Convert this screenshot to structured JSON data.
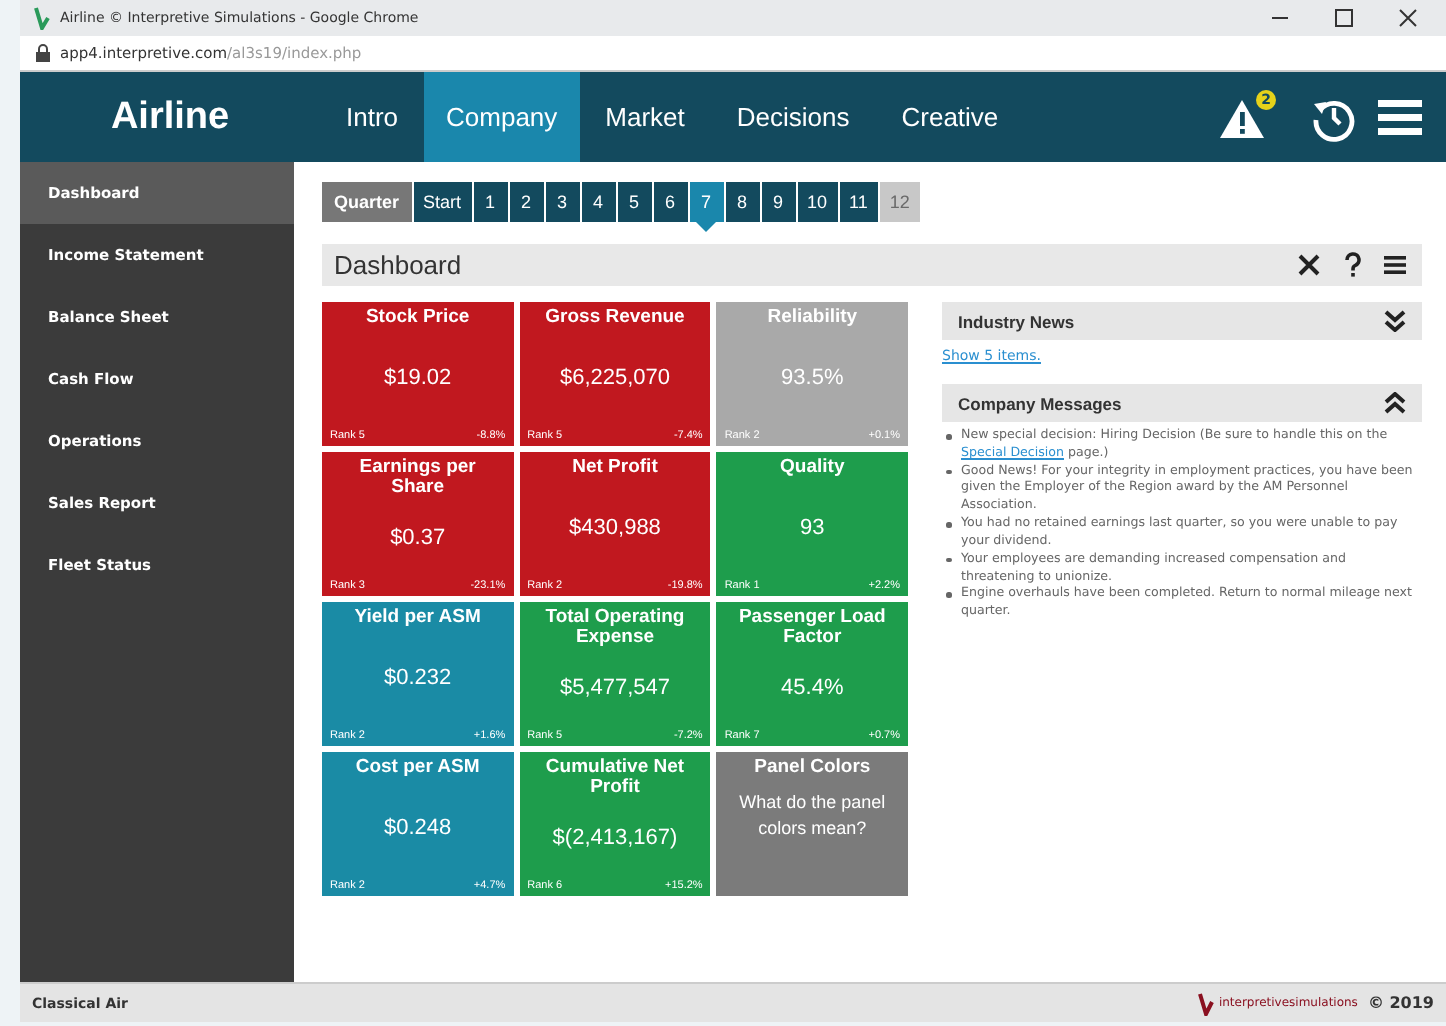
{
  "browser": {
    "title": "Airline © Interpretive Simulations - Google Chrome",
    "url_host": "app4.interpretive.com",
    "url_path": "/al3s19/index.php"
  },
  "app": {
    "brand": "Airline",
    "alert_count": "2"
  },
  "nav": [
    {
      "label": "Intro",
      "selected": false
    },
    {
      "label": "Company",
      "selected": true
    },
    {
      "label": "Market",
      "selected": false
    },
    {
      "label": "Decisions",
      "selected": false
    },
    {
      "label": "Creative",
      "selected": false
    }
  ],
  "sidebar": {
    "items": [
      {
        "label": "Dashboard",
        "selected": true
      },
      {
        "label": "Income Statement",
        "selected": false
      },
      {
        "label": "Balance Sheet",
        "selected": false
      },
      {
        "label": "Cash Flow",
        "selected": false
      },
      {
        "label": "Operations",
        "selected": false
      },
      {
        "label": "Sales Report",
        "selected": false
      },
      {
        "label": "Fleet Status",
        "selected": false
      }
    ]
  },
  "quarters": {
    "label": "Quarter",
    "items": [
      {
        "label": "Start",
        "selected": false,
        "disabled": false
      },
      {
        "label": "1",
        "selected": false,
        "disabled": false
      },
      {
        "label": "2",
        "selected": false,
        "disabled": false
      },
      {
        "label": "3",
        "selected": false,
        "disabled": false
      },
      {
        "label": "4",
        "selected": false,
        "disabled": false
      },
      {
        "label": "5",
        "selected": false,
        "disabled": false
      },
      {
        "label": "6",
        "selected": false,
        "disabled": false
      },
      {
        "label": "7",
        "selected": true,
        "disabled": false
      },
      {
        "label": "8",
        "selected": false,
        "disabled": false
      },
      {
        "label": "9",
        "selected": false,
        "disabled": false
      },
      {
        "label": "10",
        "selected": false,
        "disabled": false
      },
      {
        "label": "11",
        "selected": false,
        "disabled": false
      },
      {
        "label": "12",
        "selected": false,
        "disabled": true
      }
    ]
  },
  "dashboard": {
    "title": "Dashboard",
    "tiles": [
      {
        "kind": "metric",
        "title": "Stock Price",
        "value": "$19.02",
        "rank": "Rank 5",
        "change": "-8.8%",
        "color": "#c1181f"
      },
      {
        "kind": "metric",
        "title": "Gross Revenue",
        "value": "$6,225,070",
        "rank": "Rank 5",
        "change": "-7.4%",
        "color": "#c1181f"
      },
      {
        "kind": "metric",
        "title": "Reliability",
        "value": "93.5%",
        "rank": "Rank 2",
        "change": "+0.1%",
        "color": "#a9a9a9"
      },
      {
        "kind": "metric",
        "title": "Earnings per Share",
        "value": "$0.37",
        "rank": "Rank 3",
        "change": "-23.1%",
        "color": "#c1181f"
      },
      {
        "kind": "metric",
        "title": "Net Profit",
        "value": "$430,988",
        "rank": "Rank 2",
        "change": "-19.8%",
        "color": "#c1181f"
      },
      {
        "kind": "metric",
        "title": "Quality",
        "value": "93",
        "rank": "Rank 1",
        "change": "+2.2%",
        "color": "#1e9d4c"
      },
      {
        "kind": "metric",
        "title": "Yield per ASM",
        "value": "$0.232",
        "rank": "Rank 2",
        "change": "+1.6%",
        "color": "#1a8ba5"
      },
      {
        "kind": "metric",
        "title": "Total Operating Expense",
        "value": "$5,477,547",
        "rank": "Rank 5",
        "change": "-7.2%",
        "color": "#1e9d4c"
      },
      {
        "kind": "metric",
        "title": "Passenger Load Factor",
        "value": "45.4%",
        "rank": "Rank 7",
        "change": "+0.7%",
        "color": "#1e9d4c"
      },
      {
        "kind": "metric",
        "title": "Cost per ASM",
        "value": "$0.248",
        "rank": "Rank 2",
        "change": "+4.7%",
        "color": "#1a8ba5"
      },
      {
        "kind": "metric",
        "title": "Cumulative Net Profit",
        "value": "$(2,413,167)",
        "rank": "Rank 6",
        "change": "+15.2%",
        "color": "#1e9d4c"
      },
      {
        "kind": "info",
        "title": "Panel Colors",
        "text": "What do the panel colors mean?",
        "color": "#7b7b7b"
      }
    ]
  },
  "industry_news": {
    "title": "Industry News",
    "expanded": false,
    "link": "Show 5 items."
  },
  "company_messages": {
    "title": "Company Messages",
    "expanded": true,
    "items": [
      {
        "text": "New special decision: Hiring Decision (Be sure to handle this on the",
        "link": "Special Decision",
        "after": "page.)"
      },
      {
        "text": "Good News! For your integrity in employment practices, you have been given the Employer of the Region award by the AM Personnel Association."
      },
      {
        "text": "You had no retained earnings last quarter, so you were unable to pay your dividend."
      },
      {
        "text": "Your employees are demanding increased compensation and threatening to unionize."
      },
      {
        "text": "Engine overhauls have been completed. Return to normal mileage next quarter."
      }
    ]
  },
  "status_bar": {
    "company": "Classical Air",
    "logo": "interpretivesimulations",
    "copyright": "© 2019"
  }
}
